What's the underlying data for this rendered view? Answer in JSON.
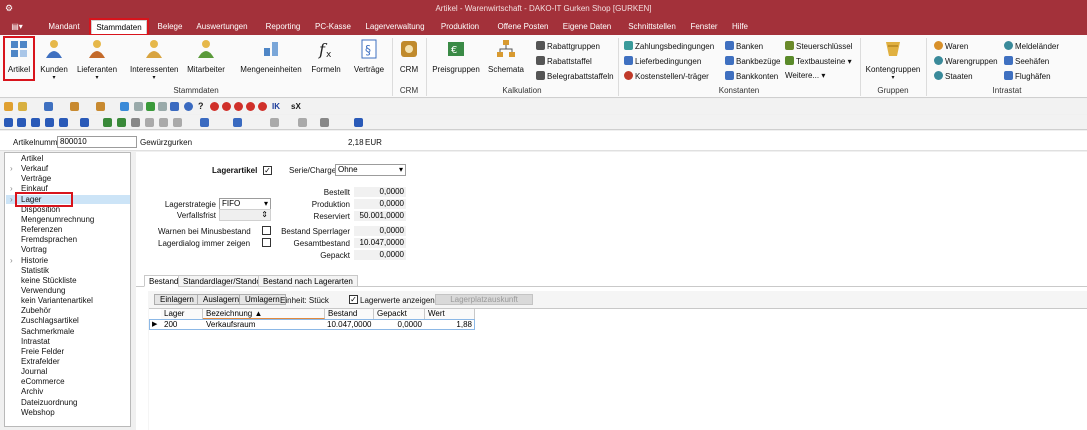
{
  "window": {
    "title": "Artikel - Warenwirtschaft - DAKO-IT Gurken Shop [GURKEN]"
  },
  "menu": {
    "items": [
      "Mandant",
      "Stammdaten",
      "Belege",
      "Auswertungen",
      "Reporting",
      "PC-Kasse",
      "Lagerverwaltung",
      "Produktion",
      "Offene Posten",
      "Eigene Daten",
      "Schnittstellen",
      "Fenster",
      "Hilfe"
    ],
    "active": "Stammdaten"
  },
  "ribbon": {
    "stammdaten": {
      "artikel": "Artikel",
      "kunden": "Kunden",
      "lieferanten": "Lieferanten",
      "interessenten": "Interessenten",
      "mitarbeiter": "Mitarbeiter",
      "mengeneinheiten": "Mengeneinheiten",
      "formeln": "Formeln",
      "vertraege": "Verträge",
      "group": "Stammdaten"
    },
    "crm": {
      "crm": "CRM",
      "group": "CRM"
    },
    "kalkulation": {
      "preisgruppen": "Preisgruppen",
      "schemata": "Schemata",
      "rabattgruppen": "Rabattgruppen",
      "rabattstaffel": "Rabattstaffel",
      "belegrabattstaffeln": "Belegrabattstaffeln",
      "group": "Kalkulation"
    },
    "konstanten": {
      "zahlungsbedingungen": "Zahlungsbedingungen",
      "lieferbedingungen": "Lieferbedingungen",
      "kostenstellen": "Kostenstellen/-träger",
      "banken": "Banken",
      "bankbezuege": "Bankbezüge",
      "bankkonten": "Bankkonten",
      "steuerschluessel": "Steuerschlüssel",
      "textbausteine": "Textbausteine",
      "weitere": "Weitere...",
      "group": "Konstanten"
    },
    "gruppen": {
      "kontengruppen": "Kontengruppen",
      "group": "Gruppen"
    },
    "intrastat": {
      "waren": "Waren",
      "warengruppen": "Warengruppen",
      "staaten": "Staaten",
      "meldelaender": "Meldeländer",
      "seehaefen": "Seehäfen",
      "flughaefen": "Flughäfen",
      "group": "Intrastat"
    }
  },
  "toolbar": {
    "ik": "IK",
    "sx": "sX"
  },
  "article": {
    "nummer_label": "Artikelnummer",
    "nummer": "800010",
    "name": "Gewürzgurken",
    "price": "2,18",
    "currency": "EUR"
  },
  "nav": {
    "items": [
      "Artikel",
      "Verkauf",
      "Verträge",
      "Einkauf",
      "Lager",
      "Disposition",
      "Mengenumrechnung",
      "Referenzen",
      "Fremdsprachen",
      "Vortrag",
      "Historie",
      "Statistik",
      "keine Stückliste",
      "Verwendung",
      "kein Variantenartikel",
      "Zubehör",
      "Zuschlagsartikel",
      "Sachmerkmale",
      "Intrastat",
      "Freie Felder",
      "Extrafelder",
      "Journal",
      "eCommerce",
      "Archiv",
      "Dateizuordnung",
      "Webshop"
    ],
    "selected": "Lager"
  },
  "lager": {
    "lagerartikel": "Lagerartikel",
    "serie_charge_label": "Serie/Charge",
    "serie_charge": "Ohne",
    "lagerstrategie_label": "Lagerstrategie",
    "lagerstrategie": "FIFO",
    "verfallsfrist_label": "Verfallsfrist",
    "warnen": "Warnen bei Minusbestand",
    "lagerdialog": "Lagerdialog immer zeigen",
    "bestellt_label": "Bestellt",
    "bestellt": "0,0000",
    "produktion_label": "Produktion",
    "produktion": "0,0000",
    "reserviert_label": "Reserviert",
    "reserviert": "50.001,0000",
    "sperrlager_label": "Bestand Sperrlager",
    "sperrlager": "0,0000",
    "gesamt_label": "Gesamtbestand",
    "gesamt": "10.047,0000",
    "gepackt_label": "Gepackt",
    "gepackt": "0,0000"
  },
  "tabs": [
    "Bestand",
    "Standardlager/Standort",
    "Bestand nach Lagerarten"
  ],
  "actions": {
    "einlagern": "Einlagern",
    "auslagern": "Auslagern",
    "umlagern": "Umlagern",
    "einheit": "Einheit: Stück",
    "lagerwerte": "Lagerwerte anzeigen",
    "lagerplatz": "Lagerplatzauskunft"
  },
  "table": {
    "columns": [
      "Lager",
      "Bezeichnung",
      "Bestand",
      "Gepackt",
      "Wert"
    ],
    "rows": [
      [
        "200",
        "Verkaufsraum",
        "10.047,0000",
        "0,0000",
        "1,88"
      ]
    ]
  },
  "colors": {
    "brand": "#a3313a",
    "highlight": "#d8141c"
  }
}
